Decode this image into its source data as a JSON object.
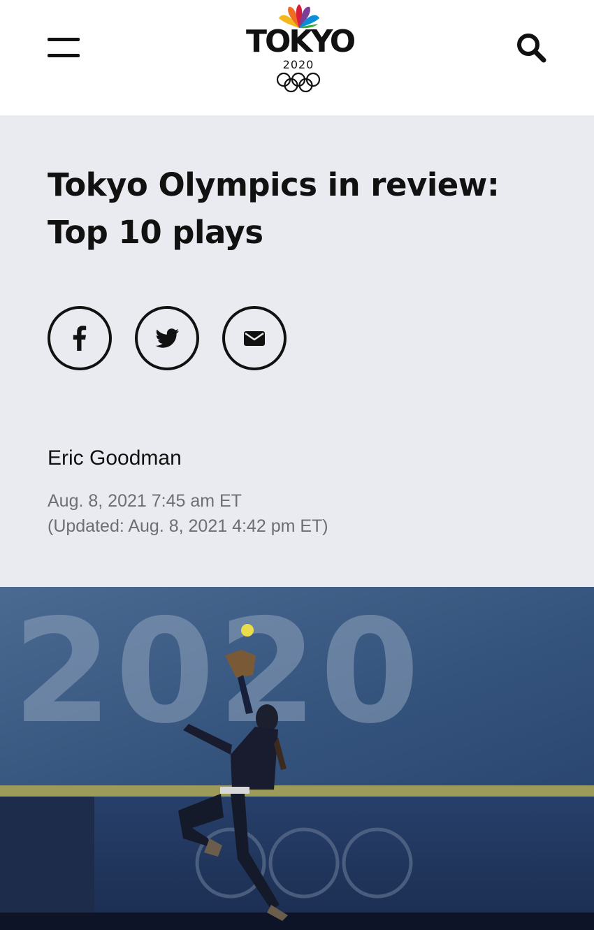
{
  "header": {
    "menu_icon": "hamburger-menu-icon",
    "logo": {
      "word": "TOKYO",
      "year": "2020",
      "icons": [
        "nbc-peacock-icon",
        "olympic-rings-icon"
      ]
    },
    "search_icon": "search-icon"
  },
  "article": {
    "title": "Tokyo Olympics in review: Top 10 plays",
    "share": {
      "icons": [
        "facebook-icon",
        "twitter-icon",
        "email-icon"
      ]
    },
    "author": "Eric Goodman",
    "published": "Aug. 8, 2021 7:45 am ET",
    "updated": "(Updated: Aug. 8, 2021 4:42 pm ET)"
  },
  "hero_image": {
    "wall_text": "2020"
  },
  "colors": {
    "header_bg": "#ffffff",
    "hero_bg": "#eaebf1",
    "text": "#111111",
    "meta_text": "#6e6e75",
    "photo_wall": "#2f4a6e"
  }
}
